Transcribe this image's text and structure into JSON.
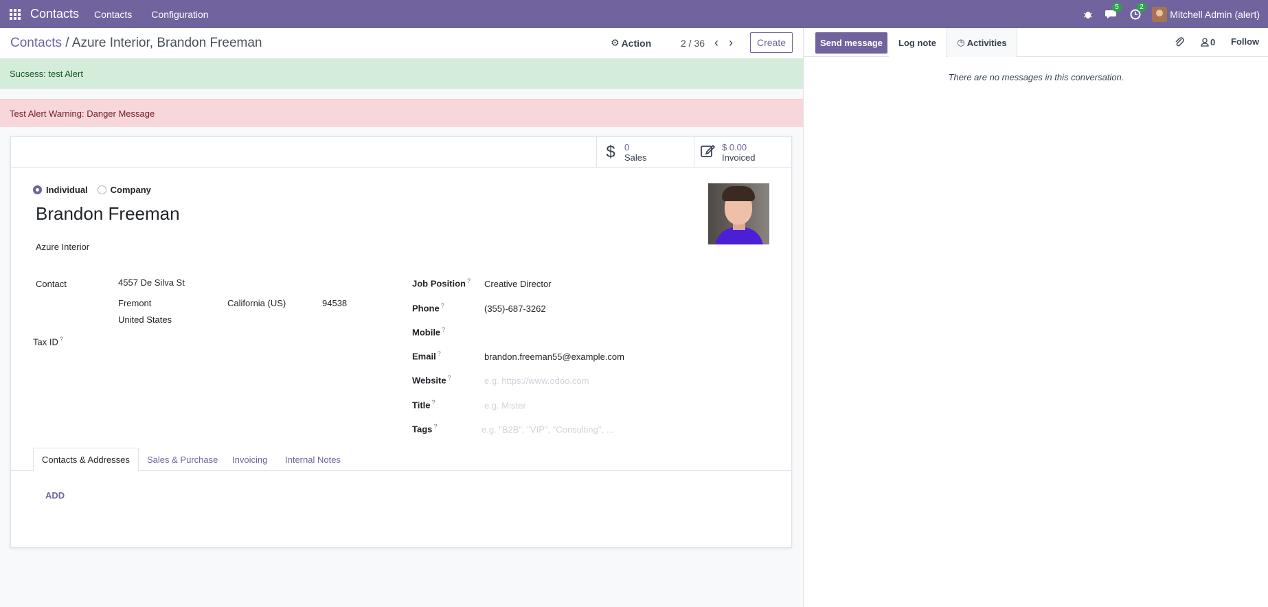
{
  "navbar": {
    "brand": "Contacts",
    "menu": [
      "Contacts",
      "Configuration"
    ],
    "messages_badge": "5",
    "activities_badge": "2",
    "user_name": "Mitchell Admin (alert)"
  },
  "control_panel": {
    "breadcrumb_root": "Contacts",
    "breadcrumb_sep": "/",
    "breadcrumb_current": "Azure Interior, Brandon Freeman",
    "action_label": "Action",
    "pager_value": "2 / 36",
    "create_label": "Create"
  },
  "alerts": {
    "success": "Sucsess: test Alert",
    "danger": "Test Alert Warning: Danger Message"
  },
  "stats": {
    "sales_value": "0",
    "sales_label": "Sales",
    "invoiced_value": "$ 0.00",
    "invoiced_label": "Invoiced"
  },
  "form": {
    "type_individual": "Individual",
    "type_company": "Company",
    "selected_type": "Individual",
    "name": "Brandon Freeman",
    "company": "Azure Interior",
    "contact_label": "Contact",
    "street": "4557 De Silva St",
    "city": "Fremont",
    "state": "California (US)",
    "zip": "94538",
    "country": "United States",
    "tax_id_label": "Tax ID",
    "job_position_label": "Job Position",
    "job_position": "Creative Director",
    "phone_label": "Phone",
    "phone": "(355)-687-3262",
    "mobile_label": "Mobile",
    "email_label": "Email",
    "email": "brandon.freeman55@example.com",
    "website_label": "Website",
    "website_placeholder": "e.g. https://www.odoo.com",
    "title_label": "Title",
    "title_placeholder": "e.g. Mister",
    "tags_label": "Tags",
    "tags_placeholder": "e.g. \"B2B\", \"VIP\", \"Consulting\", ...",
    "help_mark": "?"
  },
  "tabs": [
    "Contacts & Addresses",
    "Sales & Purchase",
    "Invoicing",
    "Internal Notes"
  ],
  "add_label": "ADD",
  "chatter": {
    "send_message": "Send message",
    "log_note": "Log note",
    "activities": "Activities",
    "followers_count": "0",
    "follow": "Follow",
    "empty": "There are no messages in this conversation."
  },
  "colors": {
    "brand": "#71639e",
    "success_bg": "#d4edda",
    "danger_bg": "#f8d7da"
  }
}
